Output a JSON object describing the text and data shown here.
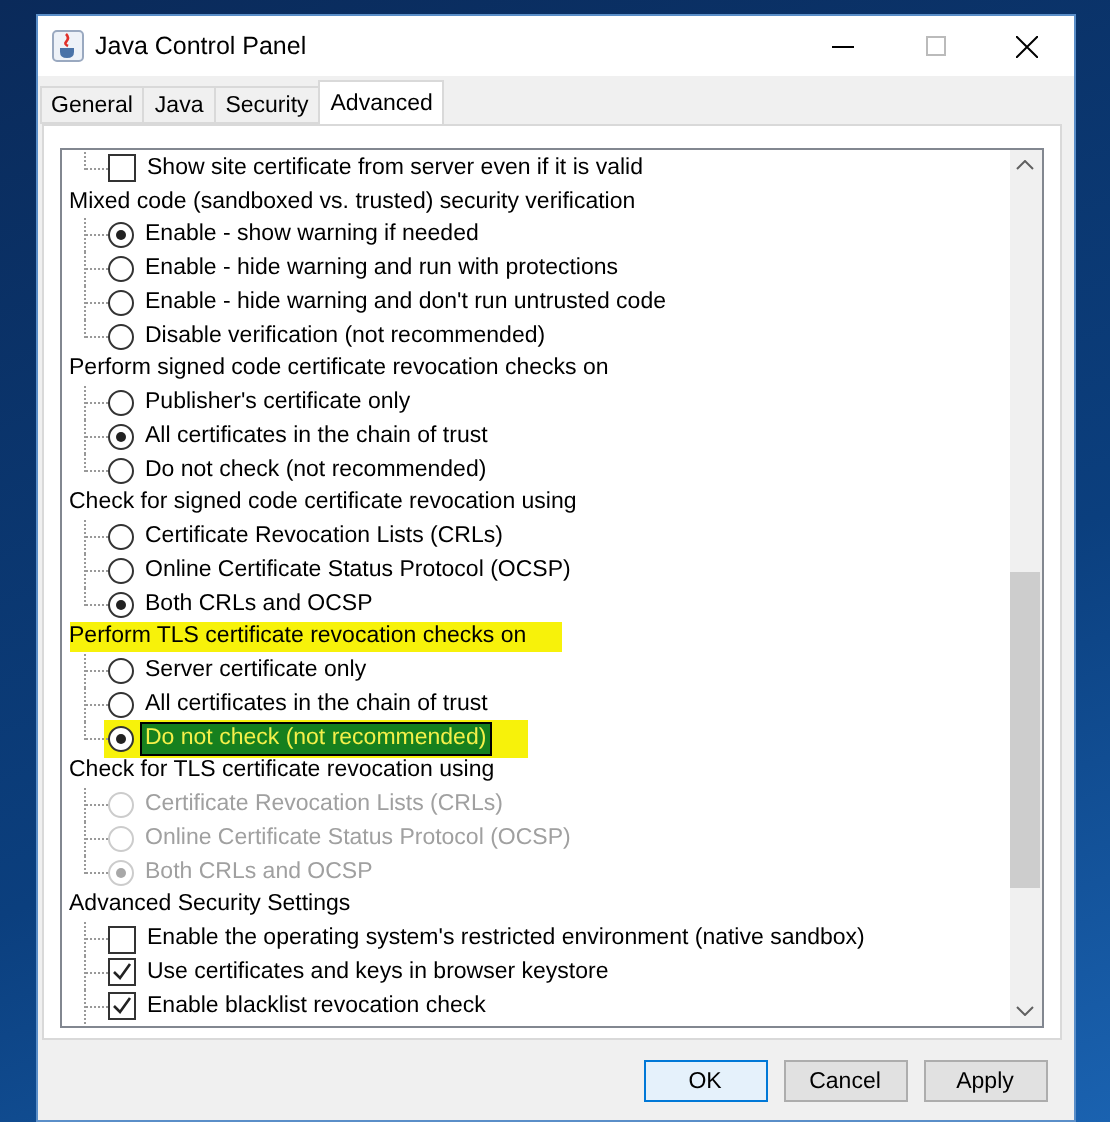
{
  "window": {
    "title": "Java Control Panel"
  },
  "tabs": [
    {
      "label": "General",
      "selected": false
    },
    {
      "label": "Java",
      "selected": false
    },
    {
      "label": "Security",
      "selected": false
    },
    {
      "label": "Advanced",
      "selected": true
    }
  ],
  "settings": [
    {
      "kind": "checkbox",
      "label": "Show site certificate from server even if it is valid",
      "checked": false,
      "last": true
    },
    {
      "kind": "header",
      "label": "Mixed code (sandboxed vs. trusted) security verification",
      "highlighted": false
    },
    {
      "kind": "radio",
      "label": "Enable - show warning if needed",
      "selected": true,
      "disabled": false,
      "last": false
    },
    {
      "kind": "radio",
      "label": "Enable - hide warning and run with protections",
      "selected": false,
      "disabled": false,
      "last": false
    },
    {
      "kind": "radio",
      "label": "Enable - hide warning and don't run untrusted code",
      "selected": false,
      "disabled": false,
      "last": false
    },
    {
      "kind": "radio",
      "label": "Disable verification (not recommended)",
      "selected": false,
      "disabled": false,
      "last": true
    },
    {
      "kind": "header",
      "label": "Perform signed code certificate revocation checks on",
      "highlighted": false
    },
    {
      "kind": "radio",
      "label": "Publisher's certificate only",
      "selected": false,
      "disabled": false,
      "last": false
    },
    {
      "kind": "radio",
      "label": "All certificates in the chain of trust",
      "selected": true,
      "disabled": false,
      "last": false
    },
    {
      "kind": "radio",
      "label": "Do not check (not recommended)",
      "selected": false,
      "disabled": false,
      "last": true
    },
    {
      "kind": "header",
      "label": "Check for signed code certificate revocation using",
      "highlighted": false
    },
    {
      "kind": "radio",
      "label": "Certificate Revocation Lists (CRLs)",
      "selected": false,
      "disabled": false,
      "last": false
    },
    {
      "kind": "radio",
      "label": "Online Certificate Status Protocol (OCSP)",
      "selected": false,
      "disabled": false,
      "last": false
    },
    {
      "kind": "radio",
      "label": "Both CRLs and OCSP",
      "selected": true,
      "disabled": false,
      "last": true
    },
    {
      "kind": "header",
      "label": "Perform TLS certificate revocation checks on",
      "highlighted": true
    },
    {
      "kind": "radio",
      "label": "Server certificate only",
      "selected": false,
      "disabled": false,
      "last": false
    },
    {
      "kind": "radio",
      "label": "All certificates in the chain of trust",
      "selected": false,
      "disabled": false,
      "last": false
    },
    {
      "kind": "radio",
      "label": "Do not check (not recommended)",
      "selected": true,
      "disabled": false,
      "focused": true,
      "highlighted": true,
      "last": true
    },
    {
      "kind": "header",
      "label": "Check for TLS certificate revocation using",
      "highlighted": false
    },
    {
      "kind": "radio",
      "label": "Certificate Revocation Lists (CRLs)",
      "selected": false,
      "disabled": true,
      "last": false
    },
    {
      "kind": "radio",
      "label": "Online Certificate Status Protocol (OCSP)",
      "selected": false,
      "disabled": true,
      "last": false
    },
    {
      "kind": "radio",
      "label": "Both CRLs and OCSP",
      "selected": true,
      "disabled": true,
      "last": true
    },
    {
      "kind": "header",
      "label": "Advanced Security Settings",
      "highlighted": false
    },
    {
      "kind": "checkbox",
      "label": "Enable the operating system's restricted environment (native sandbox)",
      "checked": false,
      "last": false
    },
    {
      "kind": "checkbox",
      "label": "Use certificates and keys in browser keystore",
      "checked": true,
      "last": false
    },
    {
      "kind": "checkbox",
      "label": "Enable blacklist revocation check",
      "checked": true,
      "last": false
    }
  ],
  "buttons": [
    {
      "label": "OK",
      "default": true
    },
    {
      "label": "Cancel",
      "default": false
    },
    {
      "label": "Apply",
      "default": false
    }
  ]
}
